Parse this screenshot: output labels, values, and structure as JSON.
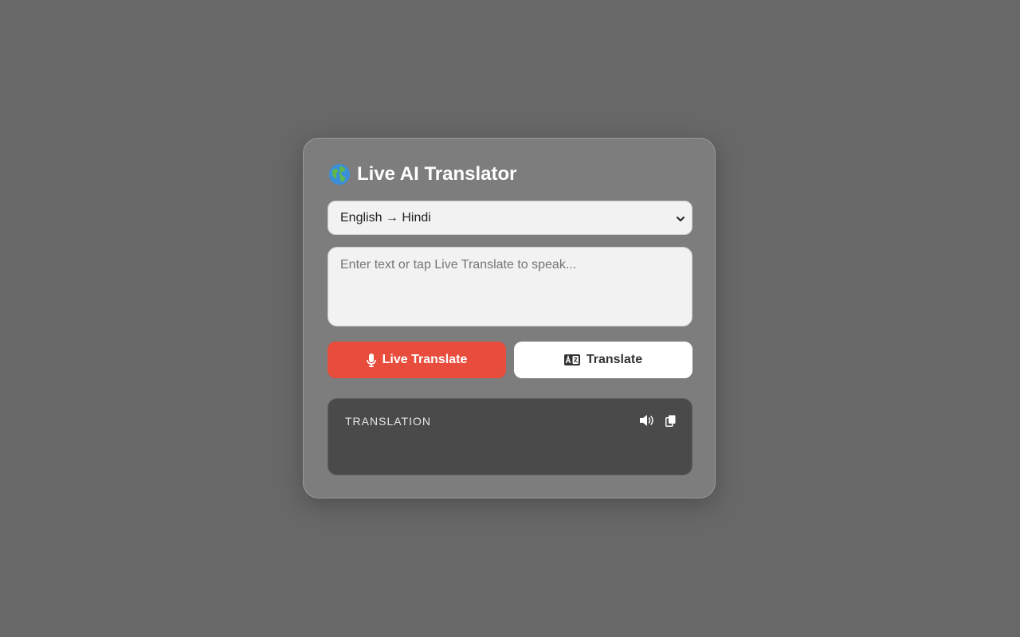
{
  "app": {
    "title": "Live AI Translator",
    "title_icon": "globe-icon"
  },
  "language_select": {
    "selected": "English → Hindi"
  },
  "input": {
    "value": "",
    "placeholder": "Enter text or tap Live Translate to speak..."
  },
  "buttons": {
    "live_label": "Live Translate",
    "live_icon": "microphone-icon",
    "translate_label": "Translate",
    "translate_icon": "language-icon"
  },
  "output": {
    "label": "TRANSLATION",
    "text": "",
    "speak_icon": "speaker-icon",
    "copy_icon": "copy-icon"
  },
  "colors": {
    "background": "#686868",
    "card": "#7d7d7d",
    "accent_red": "#e74c3c",
    "output_panel": "#4a4a4a"
  }
}
